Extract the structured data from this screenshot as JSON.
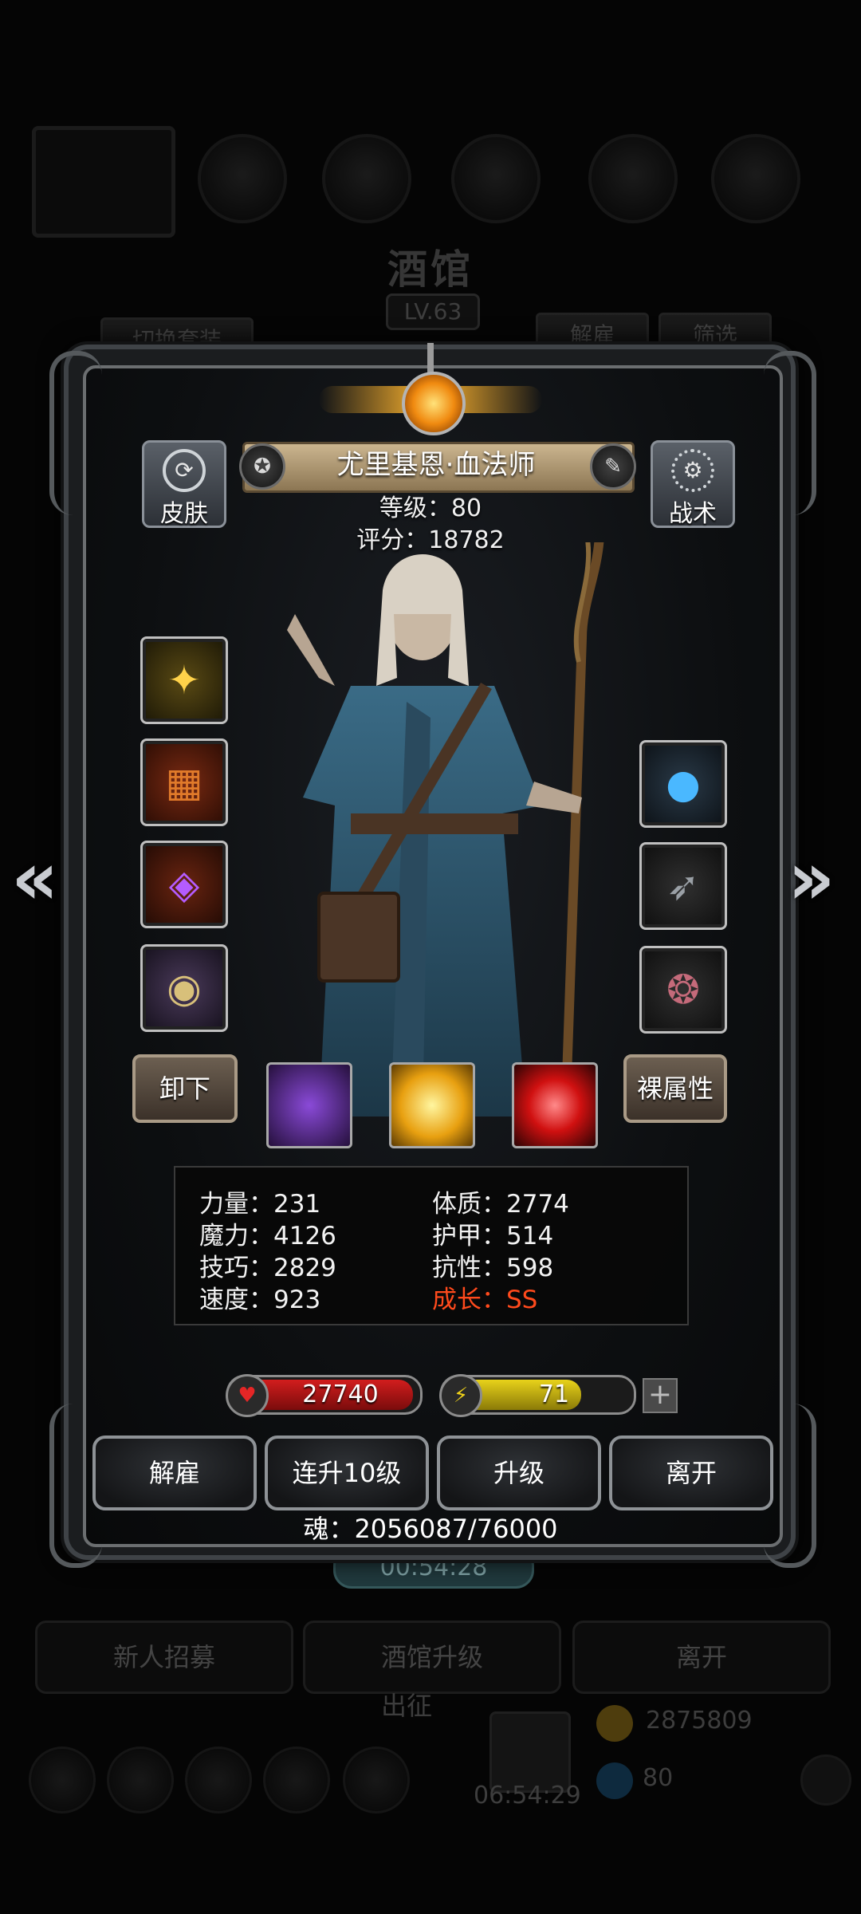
{
  "background": {
    "title": "酒馆",
    "level_badge": "LV.63",
    "switch_outfit_label": "切换套装",
    "dismiss_label": "解雇",
    "filter_label": "筛选",
    "timer": "00:54:28",
    "recruit_label": "新人招募",
    "upgrade_tavern_label": "酒馆升级",
    "leave_label": "离开",
    "expedition_label": "出征",
    "gold": "2875809",
    "gem_count": "80",
    "bottom_timer": "06:54:29"
  },
  "hero": {
    "name": "尤里基恩·血法师",
    "level_text": "等级：80",
    "score_text": "评分：18782",
    "skin_label": "皮肤",
    "tactics_label": "战术",
    "unequip_label": "卸下",
    "bare_stats_label": "裸属性"
  },
  "stats": {
    "strength": "力量：231",
    "magic": "魔力：4126",
    "skill": "技巧：2829",
    "speed": "速度：923",
    "constitution": "体质：2774",
    "armor": "护甲：514",
    "resistance": "抗性：598",
    "growth": "成长：SS"
  },
  "bars": {
    "hp_value": "27740",
    "hp_fill": 1.0,
    "energy_value": "71",
    "energy_fill": 0.71,
    "hp_color": "#d21d1d",
    "energy_color": "#e8d21a"
  },
  "actions": {
    "dismiss": "解雇",
    "level_up_10": "连升10级",
    "level_up": "升级",
    "leave": "离开"
  },
  "soul_text": "魂：2056087/76000",
  "icons": {
    "skin": "refresh-shirt-icon",
    "tactics": "gear-icon",
    "name_badge": "medal-icon",
    "edit": "pencil-icon",
    "prev": "chevron-left-icon",
    "next": "chevron-right-icon",
    "hp": "heart-icon",
    "energy": "lightning-icon",
    "add": "plus-icon"
  }
}
